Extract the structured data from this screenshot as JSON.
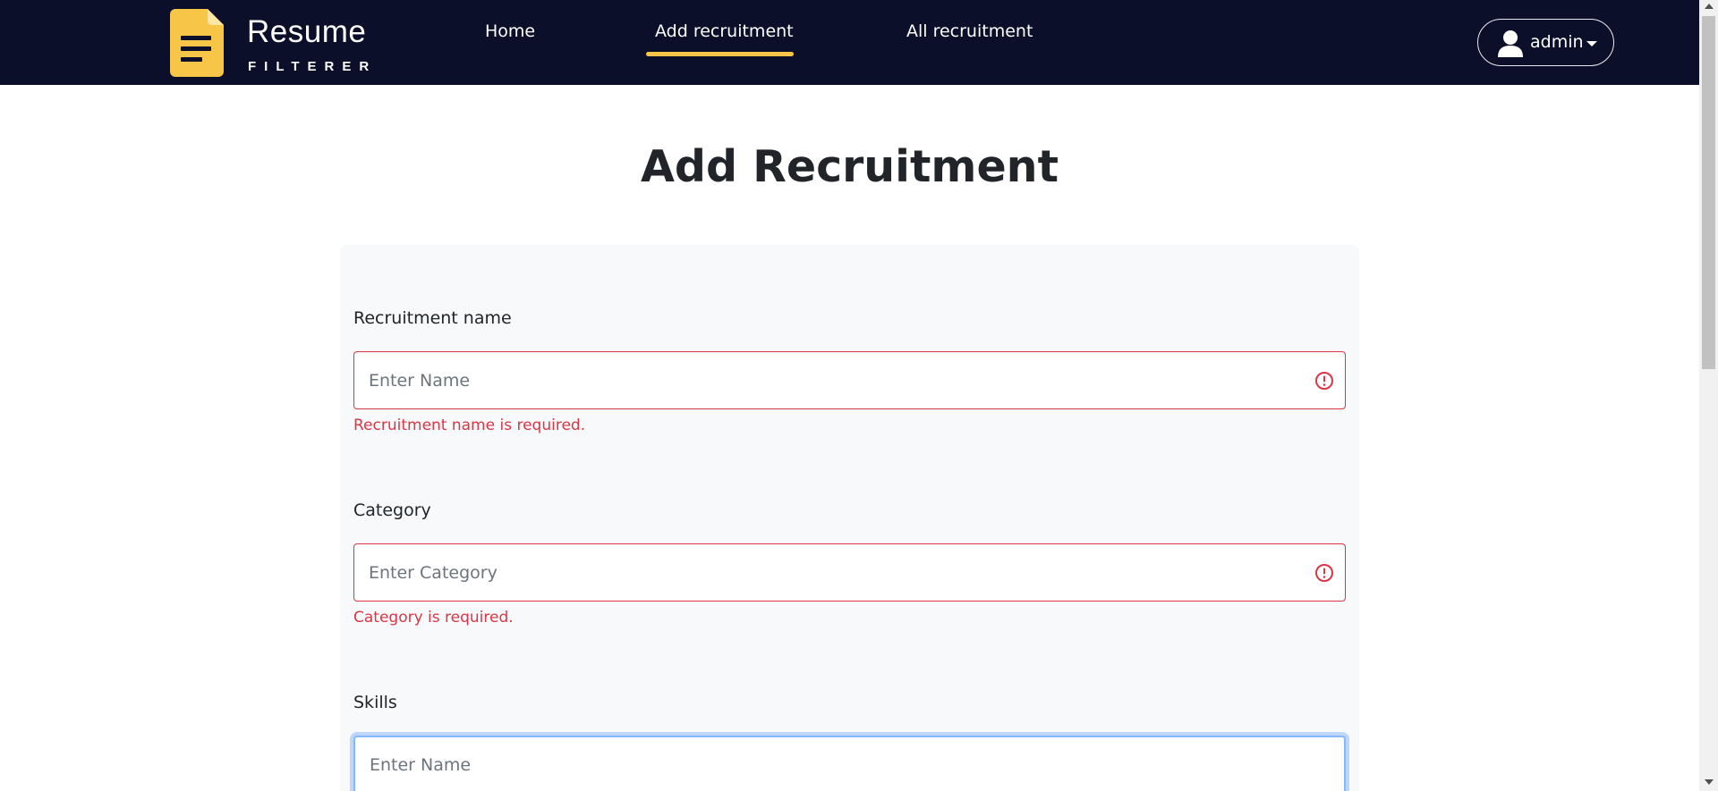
{
  "brand": {
    "name": "Resume",
    "subtitle": "FILTERER",
    "accent_color": "#f7c548",
    "nav_bg": "#0b0f2a",
    "logo_icon": "document-icon"
  },
  "nav": {
    "items": [
      {
        "label": "Home",
        "active": false
      },
      {
        "label": "Add recruitment",
        "active": true
      },
      {
        "label": "All recruitment",
        "active": false
      }
    ]
  },
  "user_menu": {
    "username": "admin",
    "icon": "user-icon",
    "dropdown_icon": "caret-down-icon"
  },
  "page": {
    "title": "Add Recruitment"
  },
  "form": {
    "error_color": "#dc3545",
    "fields": [
      {
        "label": "Recruitment name",
        "value": "",
        "placeholder": "Enter Name",
        "error": "Recruitment name is required.",
        "state": "invalid",
        "icon": "invalid-alert-icon"
      },
      {
        "label": "Category",
        "value": "",
        "placeholder": "Enter Category",
        "error": "Category is required.",
        "state": "invalid",
        "icon": "invalid-alert-icon"
      },
      {
        "label": "Skills",
        "value": "",
        "placeholder": "Enter Name",
        "error": "",
        "state": "focused"
      }
    ]
  }
}
